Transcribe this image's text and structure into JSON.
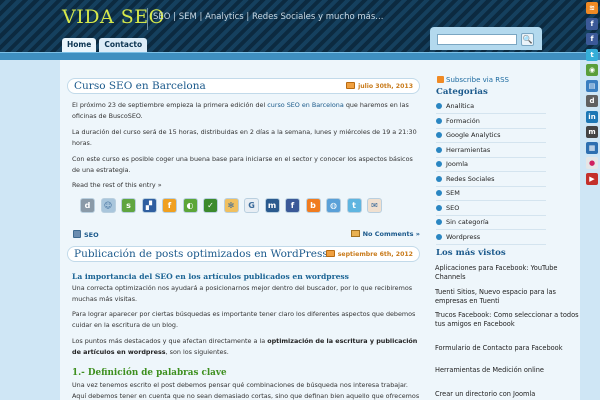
{
  "header": {
    "site_title": "VIDA SEO",
    "site_description": "SEO | SEM | Analytics | Redes Sociales y mucho más...",
    "nav": [
      "Home",
      "Contacto"
    ]
  },
  "search": {
    "button_label": "🔍",
    "value": ""
  },
  "social_icons": [
    {
      "name": "rss-icon",
      "color": "#f08a24",
      "glyph": "≋"
    },
    {
      "name": "facebook-icon",
      "color": "#3b5998",
      "glyph": "f"
    },
    {
      "name": "facebook-icon",
      "color": "#3b5998",
      "glyph": "f"
    },
    {
      "name": "twitter-icon",
      "color": "#35aed8",
      "glyph": "t"
    },
    {
      "name": "chat-icon",
      "color": "#5a9e3a",
      "glyph": "◉"
    },
    {
      "name": "delicious-icon",
      "color": "#3a7ec0",
      "glyph": "▤"
    },
    {
      "name": "digg-icon",
      "color": "#606060",
      "glyph": "d"
    },
    {
      "name": "linkedin-icon",
      "color": "#1c77b5",
      "glyph": "in"
    },
    {
      "name": "myspace-icon",
      "color": "#444444",
      "glyph": "m"
    },
    {
      "name": "delicious-icon",
      "color": "#2e6fb0",
      "glyph": "▦"
    },
    {
      "name": "flickr-icon",
      "color": "#e6e6e6",
      "glyph": "●"
    },
    {
      "name": "youtube-icon",
      "color": "#c4302b",
      "glyph": "▶"
    }
  ],
  "posts": [
    {
      "title": "Curso SEO en Barcelona",
      "date": "julio 30th, 2013",
      "paragraph1_pre": "El próximo 23 de septiembre empieza la primera edición del ",
      "paragraph1_link": "curso SEO en Barcelona",
      "paragraph1_post": " que haremos en las oficinas de BuscoSEO.",
      "paragraph2": "La duración del curso será de 15 horas, distribuidas en 2 días a la semana, lunes y miércoles de 19 a 21:30 horas.",
      "paragraph3": "Con este curso es posible coger una buena base para iniciarse en el sector y conocer los aspectos básicos de una estrategia.",
      "read_more": "Read the rest of this entry »",
      "category": "SEO",
      "comments": "No Comments »"
    },
    {
      "title": "Publicación de posts optimizados en WordPress",
      "date": "septiembre 6th, 2012",
      "subheading": "La importancia del SEO en los artículos publicados en wordpress",
      "paragraph1": "Una correcta optimización nos ayudará a posicionarnos mejor dentro del buscador, por lo que recibiremos muchas más visitas.",
      "paragraph2": "Para lograr aparecer por ciertas búsquedas es importante tener claro los diferentes aspectos que debemos cuidar en la escritura de un blog.",
      "paragraph3_pre": "Los puntos más destacados y que afectan directamente a la ",
      "paragraph3_bold": "optimización de la escritura y publicación de artículos en wordpress",
      "paragraph3_post": ", son los siguientes.",
      "h2": "1.- Definición de palabras clave",
      "paragraph4": "Una vez tenemos escrito el post debemos pensar qué combinaciones de búsqueda nos interesa trabajar. Aquí debemos tener en cuenta que no sean demasiado cortas, sino que definan bien aquello que ofrecemos y que"
    }
  ],
  "share_icons": [
    {
      "name": "digg-share-icon",
      "color": "#8a9aa8",
      "glyph": "d"
    },
    {
      "name": "reddit-share-icon",
      "color": "#a9c6dc",
      "glyph": "☺"
    },
    {
      "name": "stumbleupon-share-icon",
      "color": "#5fa540",
      "glyph": "s"
    },
    {
      "name": "delicious-share-icon",
      "color": "#2f5fa0",
      "glyph": "▞"
    },
    {
      "name": "friendfeed-share-icon",
      "color": "#f0a020",
      "glyph": "f"
    },
    {
      "name": "chat-share-icon",
      "color": "#5ca638",
      "glyph": "◐"
    },
    {
      "name": "sphinn-share-icon",
      "color": "#3c8a2c",
      "glyph": "✓"
    },
    {
      "name": "netvibes-share-icon",
      "color": "#f0c060",
      "glyph": "✻"
    },
    {
      "name": "google-share-icon",
      "color": "#e8eef4",
      "glyph": "G"
    },
    {
      "name": "myspace-share-icon",
      "color": "#2a5a8e",
      "glyph": "m"
    },
    {
      "name": "facebook-share-icon",
      "color": "#3b5998",
      "glyph": "f"
    },
    {
      "name": "blogger-share-icon",
      "color": "#f07c20",
      "glyph": "b"
    },
    {
      "name": "globe-share-icon",
      "color": "#5aa0d8",
      "glyph": "◍"
    },
    {
      "name": "twitter-share-icon",
      "color": "#5fb5e0",
      "glyph": "t"
    },
    {
      "name": "email-share-icon",
      "color": "#f0e0d0",
      "glyph": "✉"
    }
  ],
  "sidebar": {
    "rss_link": "Subscribe via RSS",
    "categories_title": "Categorias",
    "categories": [
      "Analítica",
      "Formación",
      "Google Analytics",
      "Herramientas",
      "Joomla",
      "Redes Sociales",
      "SEM",
      "SEO",
      "Sin categoría",
      "Wordpress"
    ],
    "most_viewed_title": "Los más vistos",
    "most_viewed": [
      "Aplicaciones para Facebook: YouTube Channels",
      "Tuenti Sitios, Nuevo espacio para las empresas en Tuenti",
      "Trucos Facebook: Como seleccionar a todos tus amigos en Facebook",
      "Formulario de Contacto para Facebook",
      "Herramientas de Medición online",
      "Crear un directorio con Joomla"
    ]
  }
}
